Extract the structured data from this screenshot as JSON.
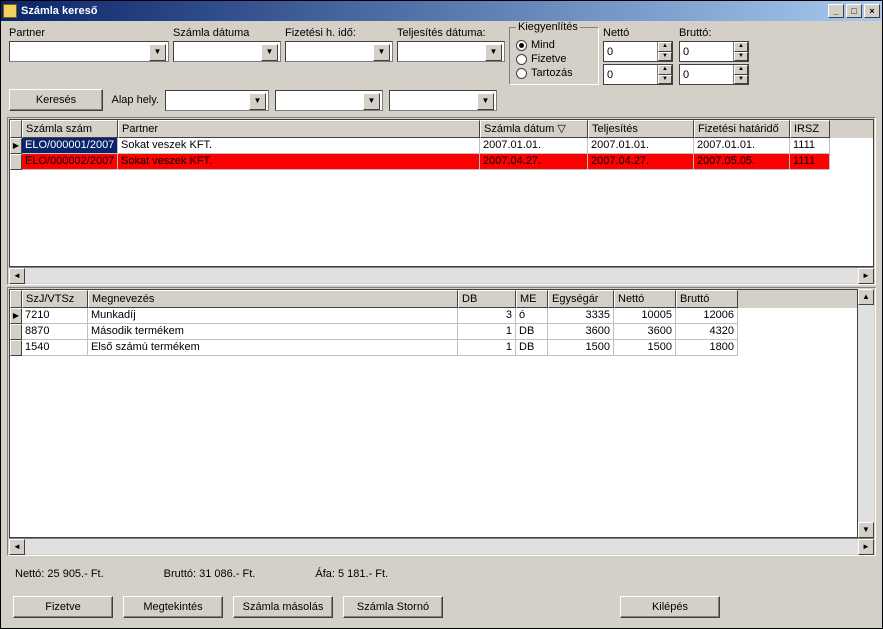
{
  "window": {
    "title": "Számla kereső"
  },
  "filters": {
    "partner_label": "Partner",
    "szamla_datuma_label": "Számla dátuma",
    "fizetesi_hido_label": "Fizetési h. idő:",
    "teljesites_datuma_label": "Teljesítés dátuma:",
    "kereses_btn": "Keresés",
    "alap_hely_label": "Alap hely."
  },
  "kiegyenlites": {
    "legend": "Kiegyenlítés",
    "opt_mind": "Mind",
    "opt_fizetve": "Fizetve",
    "opt_tartozas": "Tartozás",
    "selected": "Mind"
  },
  "amounts": {
    "netto_label": "Nettó",
    "netto_value": "0",
    "brutto_label": "Bruttó:",
    "brutto_value": "0"
  },
  "invoices": {
    "headers": {
      "szamla_szam": "Számla szám",
      "partner": "Partner",
      "szamla_datum": "Számla dátum",
      "teljesites": "Teljesítés",
      "fizetesi_hatarido": "Fizetési határidő",
      "irsz": "IRSZ"
    },
    "rows": [
      {
        "szam": "ELO/000001/2007",
        "partner": "Sokat veszek KFT.",
        "datum": "2007.01.01.",
        "telj": "2007.01.01.",
        "hatar": "2007.01.01.",
        "irsz": "1111",
        "highlighted": false,
        "red": false
      },
      {
        "szam": "ELO/000002/2007",
        "partner": "Sokat veszek KFT.",
        "datum": "2007.04.27.",
        "telj": "2007.04.27.",
        "hatar": "2007.05.05.",
        "irsz": "1111",
        "highlighted": false,
        "red": true
      }
    ]
  },
  "items": {
    "headers": {
      "szjvtsz": "SzJ/VTSz",
      "megnevezes": "Megnevezés",
      "db": "DB",
      "me": "ME",
      "egysegar": "Egységár",
      "netto": "Nettó",
      "brutto": "Bruttó"
    },
    "rows": [
      {
        "szj": "7210",
        "meg": "Munkadíj",
        "db": "3",
        "me": "ó",
        "egy": "3335",
        "netto": "10005",
        "brutto": "12006"
      },
      {
        "szj": "8870",
        "meg": "Második termékem",
        "db": "1",
        "me": "DB",
        "egy": "3600",
        "netto": "3600",
        "brutto": "4320"
      },
      {
        "szj": "1540",
        "meg": "Első számú termékem",
        "db": "1",
        "me": "DB",
        "egy": "1500",
        "netto": "1500",
        "brutto": "1800"
      }
    ]
  },
  "totals": {
    "netto": "Nettó:   25 905.- Ft.",
    "brutto": "Bruttó:   31 086.- Ft.",
    "afa": "Áfa:    5 181.- Ft."
  },
  "buttons": {
    "fizetve": "Fizetve",
    "megtekintes": "Megtekintés",
    "szamla_masolas": "Számla másolás",
    "szamla_storno": "Számla Stornó",
    "kilepes": "Kilépés"
  }
}
